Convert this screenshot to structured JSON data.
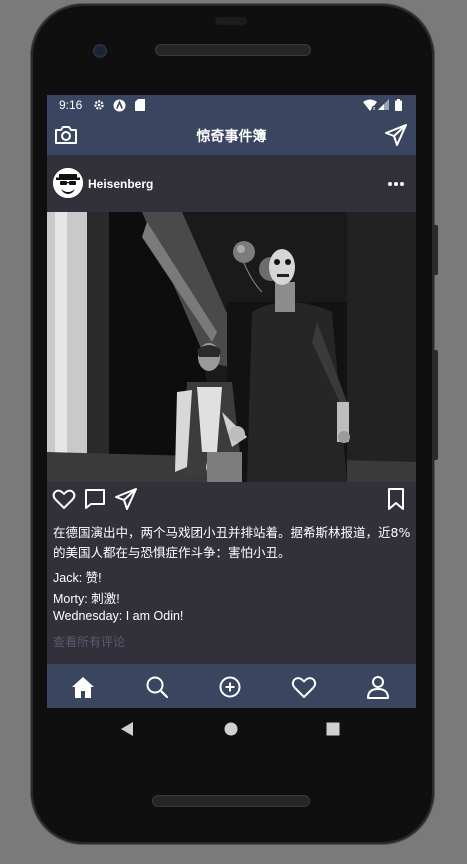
{
  "status_bar": {
    "time": "9:16",
    "icons": [
      "gear-icon",
      "a-circle-icon",
      "sd-card-icon",
      "wifi-icon",
      "signal-icon",
      "battery-icon"
    ]
  },
  "app_bar": {
    "title": "惊奇事件簿",
    "left_icon": "camera-icon",
    "right_icon": "send-icon"
  },
  "post": {
    "username": "Heisenberg",
    "caption": "在德国演出中，两个马戏团小丑并排站着。据希斯林报道，近8%的美国人都在与恐惧症作斗争：害怕小丑。",
    "comments": [
      {
        "text": "Jack: 赞!"
      },
      {
        "text": "Morty: 刺激!"
      },
      {
        "text": "Wednesday: I am Odin!"
      }
    ],
    "view_all_comments": "查看所有评论"
  },
  "bottom_nav": [
    "home-icon",
    "search-icon",
    "add-icon",
    "heart-icon",
    "profile-icon"
  ],
  "colors": {
    "bar": "#3a4560",
    "background": "#323039",
    "muted_text": "#555d70"
  }
}
